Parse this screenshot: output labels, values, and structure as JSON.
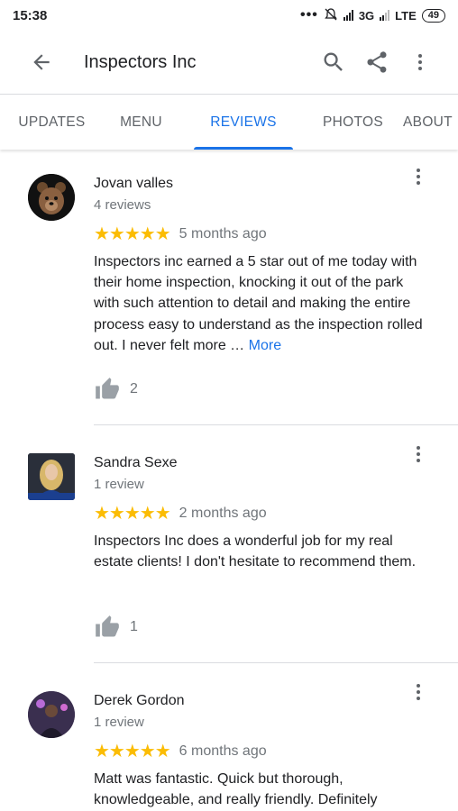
{
  "status_bar": {
    "time": "15:38",
    "network_3g": "3G",
    "network_lte": "LTE",
    "battery": "49",
    "icons": [
      "overflow-dots-icon",
      "alarm-muted-icon",
      "signal-icon",
      "signal-icon",
      "battery-icon"
    ]
  },
  "toolbar": {
    "title": "Inspectors Inc",
    "back_icon": "arrow-left-icon",
    "actions": [
      "search-icon",
      "share-icon",
      "more-vert-icon"
    ]
  },
  "tabs": [
    {
      "label": "UPDATES",
      "active": false
    },
    {
      "label": "MENU",
      "active": false
    },
    {
      "label": "REVIEWS",
      "active": true
    },
    {
      "label": "PHOTOS",
      "active": false
    },
    {
      "label": "ABOUT",
      "active": false
    }
  ],
  "accent_color": "#1a73e8",
  "star_color": "#fbbc04",
  "reviews": [
    {
      "name": "Jovan valles",
      "count": "4 reviews",
      "stars": "★★★★★",
      "rating": 5,
      "date": "5 months ago",
      "text": "Inspectors inc earned a 5 star out of me today with their home inspection, knocking it out of the park with such attention to detail and making the entire process easy to understand as the inspection rolled out. I never felt more …",
      "more": "More",
      "likes": "2"
    },
    {
      "name": "Sandra Sexe",
      "count": "1 review",
      "stars": "★★★★★",
      "rating": 5,
      "date": "2 months ago",
      "text": "Inspectors Inc does a wonderful job for my real estate clients! I don't hesitate to recommend them.",
      "more": "",
      "likes": "1"
    },
    {
      "name": "Derek Gordon",
      "count": "1 review",
      "stars": "★★★★★",
      "rating": 5,
      "date": "6 months ago",
      "text": "Matt was fantastic. Quick but thorough, knowledgeable, and really friendly. Definitely",
      "more": "",
      "likes": ""
    }
  ]
}
